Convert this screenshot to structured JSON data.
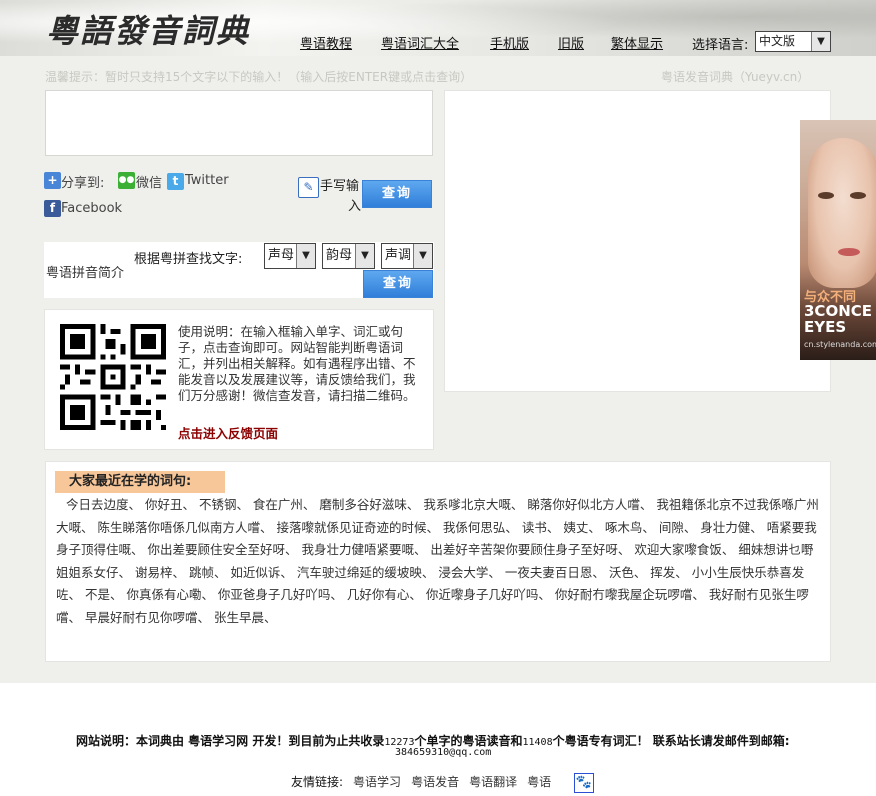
{
  "header": {
    "logo_text": "粵語發音詞典",
    "nav": [
      "粤语教程",
      "粤语词汇大全",
      "手机版",
      "旧版",
      "繁体显示"
    ],
    "language_label": "选择语言:",
    "language_selected": "中文版"
  },
  "tip_text": "温馨提示：暂时只支持15个文字以下的输入！（输入后按ENTER键或点击查询）",
  "site_tag": "粤语发音词典（Yueyv.cn）",
  "share": {
    "label": "分享到:",
    "wechat": "微信",
    "twitter": "Twitter",
    "facebook": "Facebook"
  },
  "handwrite_line1": "手写输",
  "handwrite_line2": "入",
  "query_button": "查询",
  "pinyin": {
    "lookup_label": "根据粤拼查找文字:",
    "intro_link": "粤语拼音简介",
    "initial": "声母",
    "final": "韵母",
    "tone": "声调",
    "query_button": "查询"
  },
  "ad": {
    "cn": "与众不同",
    "en1": "3CONCE",
    "en2": "EYES",
    "url": "cn.stylenanda.com"
  },
  "usage_text": "使用说明：在输入框输入单字、词汇或句子，点击查询即可。网站智能判断粤语词汇，并列出相关解释。如有遇程序出错、不能发音以及发展建议等，请反馈给我们，我们万分感谢！微信查发音，请扫描二维码。",
  "feedback_link": "点击进入反馈页面",
  "recent": {
    "title": "大家最近在学的词句:",
    "words": "今日去边度、 你好丑、 不锈钢、 食在广州、 磨制多谷好滋味、 我系嗲北京大嘅、 睇落你好似北方人嚐、 我祖籍係北京不过我係喺广州大嘅、 陈生睇落你唔係几似南方人嚐、 接落嚟就係见证奇迹的时候、 我係何思弘、 读书、 姨丈、 啄木鸟、 间隙、 身壮力健、 唔紧要我身子顶得住嘅、 你出差要顾住安全至好呀、 我身壮力健唔紧要嘅、 出差好辛苦架你要顾住身子至好呀、 欢迎大家嚟食饭、 细妹想讲乜嘢姐姐系女仔、 谢易梓、 跳帧、 如近似诉、 汽车驶过绵延的缓坡映、 浸会大学、 一夜夫妻百日恩、 沃色、 挥发、 小小生辰快乐恭喜发咗、 不是、 你真係有心嘞、 你亚爸身子几好吖吗、 几好你有心、 你近嚟身子几好吖吗、 你好耐冇嚟我屋企玩啰嚐、 我好耐冇见张生啰嚐、 早晨好耐冇见你啰嚐、 张生早晨、"
  },
  "footer": {
    "line1": "网站说明：本词典由 粤语学习网 开发！到目前为止共收录",
    "num1": "12273",
    "line1b": "个单字的粤语读音和",
    "num2": "11408",
    "line1c": "个粤语专有词汇！  联系站长请发邮件到邮箱:",
    "email": "384659310@qq.com",
    "friends_label": "友情链接:",
    "friends": [
      "粤语学习",
      "粤语发音",
      "粤语翻译",
      "粤语"
    ]
  },
  "colors": {
    "band": "#efefec",
    "button_blue": "#2f7ed9",
    "recent_title_bg": "#f7c79a",
    "feedback_red": "#8b0000"
  },
  "icons": {
    "share": "plus-square-icon",
    "wechat": "wechat-icon",
    "twitter": "twitter-icon",
    "facebook": "facebook-icon",
    "handwrite": "pen-pad-icon",
    "qr": "qr-code-icon",
    "baidu": "paw-icon"
  }
}
